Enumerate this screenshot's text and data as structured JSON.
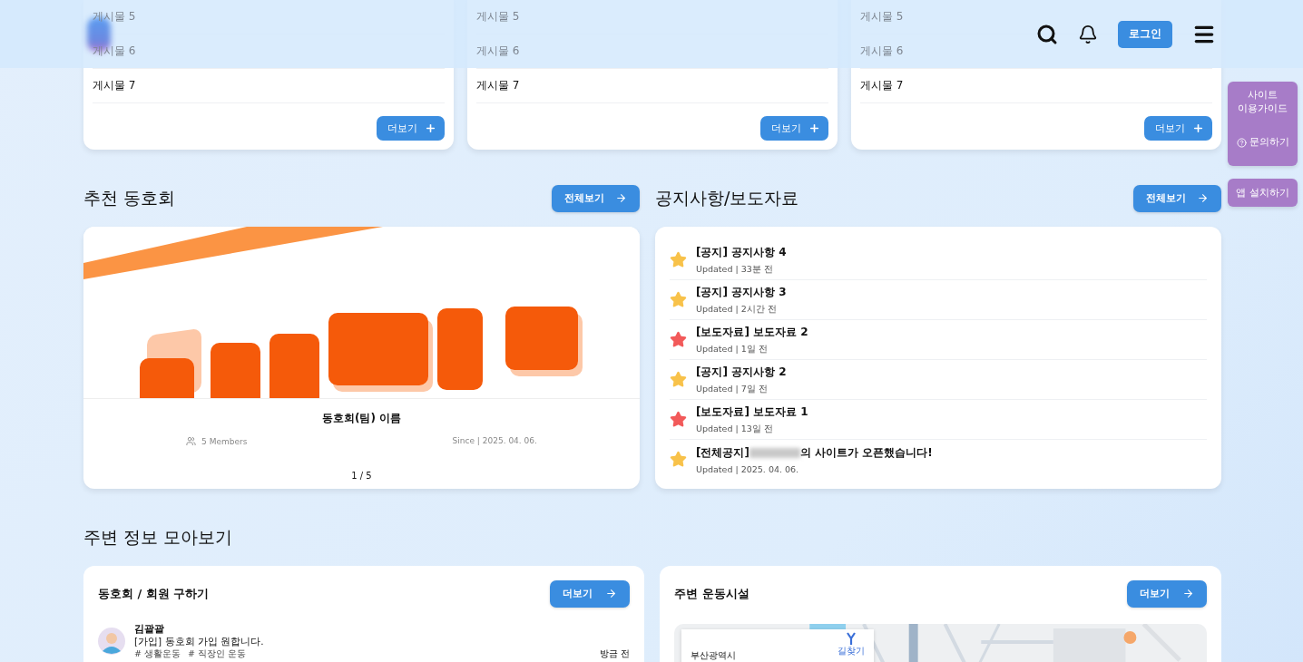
{
  "header": {
    "login": "로그인"
  },
  "board_cards": [
    {
      "posts": [
        "게시물 5",
        "게시물 6",
        "게시물 7"
      ],
      "more": "더보기"
    },
    {
      "posts": [
        "게시물 5",
        "게시물 6",
        "게시물 7"
      ],
      "more": "더보기"
    },
    {
      "posts": [
        "게시물 5",
        "게시물 6",
        "게시물 7"
      ],
      "more": "더보기"
    }
  ],
  "side_panel": {
    "guide": "사이트\n이용가이드",
    "inquiry": "문의하기",
    "app": "앱 설치하기"
  },
  "clubs": {
    "title": "추천 동호회",
    "view_all": "전체보기",
    "card": {
      "kind": "picture",
      "name": "동호회(팀) 이름",
      "members": "5 Members",
      "since": "Since | 2025. 04. 06.",
      "pager": "1 / 5"
    }
  },
  "notices": {
    "title": "공지사항/보도자료",
    "view_all": "전체보기",
    "items": [
      {
        "title": "[공지] 공지사항 4",
        "updated": "Updated | 33분 전",
        "color": "#f8c24a"
      },
      {
        "title": "[공지] 공지사항 3",
        "updated": "Updated | 2시간 전",
        "color": "#f8c24a"
      },
      {
        "title": "[보도자료] 보도자료 2",
        "updated": "Updated | 1일 전",
        "color": "#f25a5a"
      },
      {
        "title": "[공지] 공지사항 2",
        "updated": "Updated | 7일 전",
        "color": "#f8c24a"
      },
      {
        "title": "[보도자료] 보도자료 1",
        "updated": "Updated | 13일 전",
        "color": "#f25a5a"
      },
      {
        "title": "[전체공지]",
        "redacted": true,
        "title_after": "의 사이트가 오픈했습니다!",
        "updated": "Updated | 2025. 04. 06.",
        "color": "#f8c24a"
      }
    ]
  },
  "nearby": {
    "title": "주변 정보 모아보기",
    "recruit": {
      "title": "동호회 / 회원 구하기",
      "more": "더보기",
      "posts": [
        {
          "author": "김괄괄",
          "text": "[가입] 동호회 가입 원합니다.",
          "tags": [
            "# 생활운동",
            "# 직장인 운동"
          ],
          "time": "방금 전"
        }
      ]
    },
    "facilities": {
      "title": "주변 운동시설",
      "more": "더보기",
      "map": {
        "region": "부산광역시",
        "directions": "길찾기"
      }
    }
  }
}
